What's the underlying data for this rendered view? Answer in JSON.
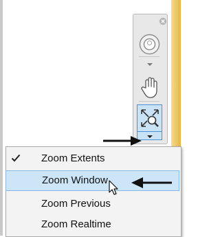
{
  "zoom_menu": {
    "items": [
      {
        "label": "Zoom Extents",
        "checked": true
      },
      {
        "label": "Zoom Window",
        "highlighted": true
      },
      {
        "label": "Zoom Previous"
      },
      {
        "label": "Zoom Realtime"
      }
    ]
  },
  "navigation_bar": {
    "tools": [
      "steering-wheel",
      "pan",
      "zoom-extents"
    ],
    "accent_color": "#4a90d9",
    "highlight_color": "#cde6f7"
  },
  "icons": {
    "close": "close-icon",
    "wheel": "steering-wheel-icon",
    "pan": "pan-hand-icon",
    "zoom": "zoom-extents-icon",
    "check": "checkmark-icon",
    "cursor": "mouse-pointer-icon",
    "annotation_arrow": "black-arrow-icon"
  }
}
